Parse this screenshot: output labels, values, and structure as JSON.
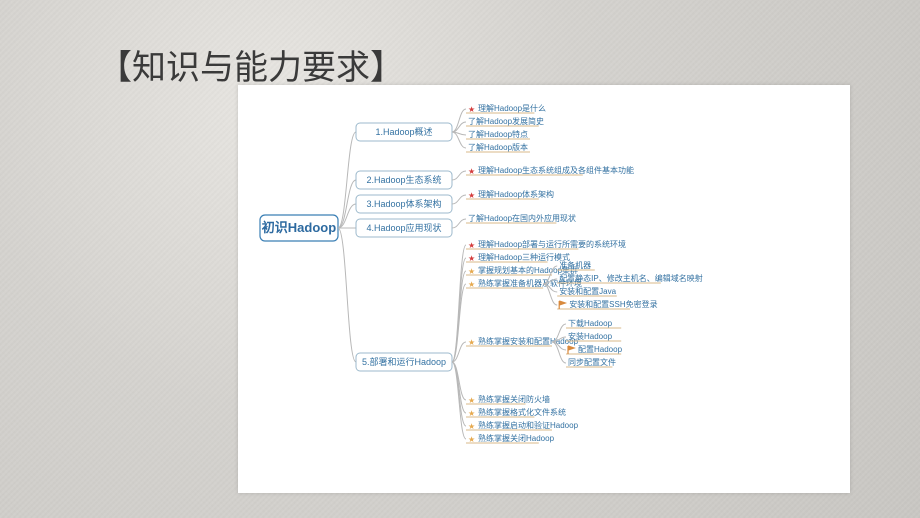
{
  "title": "【知识与能力要求】",
  "mindmap": {
    "root": "初识Hadoop",
    "branches": [
      {
        "label": "1.Hadoop概述",
        "children": [
          {
            "t": "理解Hadoop是什么",
            "m": "red"
          },
          {
            "t": "了解Hadoop发展简史"
          },
          {
            "t": "了解Hadoop特点"
          },
          {
            "t": "了解Hadoop版本"
          }
        ]
      },
      {
        "label": "2.Hadoop生态系统",
        "children": [
          {
            "t": "理解Hadoop生态系统组成及各组件基本功能",
            "m": "red"
          }
        ]
      },
      {
        "label": "3.Hadoop体系架构",
        "children": [
          {
            "t": "理解Hadoop体系架构",
            "m": "red"
          }
        ]
      },
      {
        "label": "4.Hadoop应用现状",
        "children": [
          {
            "t": "了解Hadoop在国内外应用现状"
          }
        ]
      },
      {
        "label": "5.部署和运行Hadoop",
        "children": [
          {
            "t": "理解Hadoop部署与运行所需要的系统环境",
            "m": "red"
          },
          {
            "t": "理解Hadoop三种运行模式",
            "m": "red"
          },
          {
            "t": "掌握规划基本的Hadoop集群",
            "m": "orange"
          },
          {
            "t": "熟练掌握准备机器及软件环境",
            "m": "orange",
            "children": [
              {
                "t": "准备机器"
              },
              {
                "t": "配置静态IP、修改主机名、编辑域名映射"
              },
              {
                "t": "安装和配置Java"
              },
              {
                "t": "安装和配置SSH免密登录",
                "m": "flag"
              }
            ]
          },
          {
            "t": "熟练掌握安装和配置Hadoop",
            "m": "orange",
            "children": [
              {
                "t": "下载Hadoop"
              },
              {
                "t": "安装Hadoop"
              },
              {
                "t": "配置Hadoop",
                "m": "flag"
              },
              {
                "t": "同步配置文件"
              }
            ]
          },
          {
            "t": "熟练掌握关闭防火墙",
            "m": "orange"
          },
          {
            "t": "熟练掌握格式化文件系统",
            "m": "orange"
          },
          {
            "t": "熟练掌握启动和验证Hadoop",
            "m": "orange"
          },
          {
            "t": "熟练掌握关闭Hadoop",
            "m": "orange"
          }
        ]
      }
    ]
  }
}
